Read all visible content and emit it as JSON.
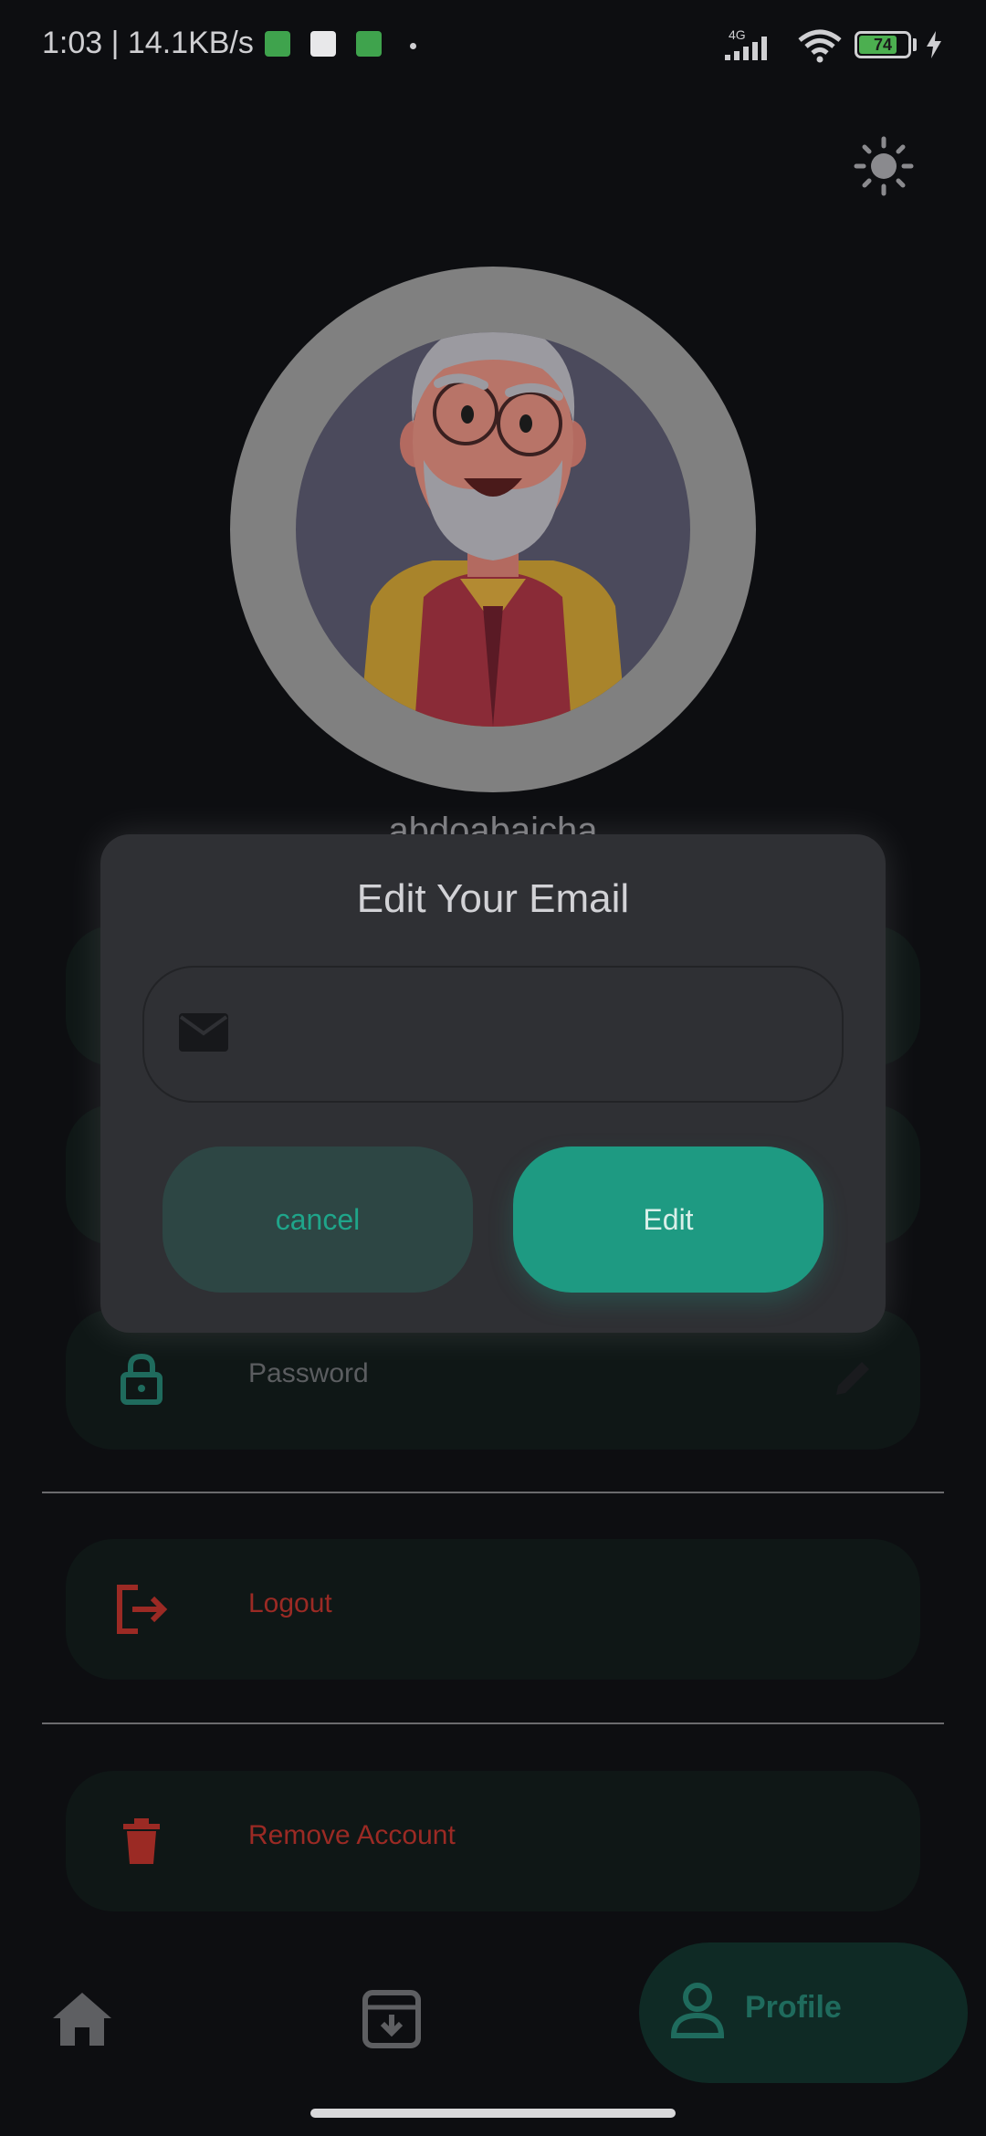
{
  "status_bar": {
    "time": "1:03 | 14.1KB/s",
    "network": "4G",
    "battery": "74"
  },
  "profile": {
    "username": "abdoabaicha",
    "rows": [
      {
        "label": "Password",
        "icon": "lock-icon",
        "color": "#1f6b5d"
      },
      {
        "label": "Logout",
        "icon": "logout-icon",
        "color": "#9b2a24"
      },
      {
        "label": "Remove Account",
        "icon": "trash-icon",
        "color": "#9b2a24"
      }
    ]
  },
  "dialog": {
    "title": "Edit Your Email",
    "email_value": "",
    "email_placeholder": "",
    "cancel_label": "cancel",
    "edit_label": "Edit"
  },
  "bottom_nav": {
    "home_icon": "home-icon",
    "archive_icon": "archive-icon",
    "profile_label": "Profile"
  },
  "colors": {
    "accent": "#1e9a82",
    "danger": "#9b2a24",
    "background": "#0d0e11",
    "dialog": "#2f3034"
  }
}
